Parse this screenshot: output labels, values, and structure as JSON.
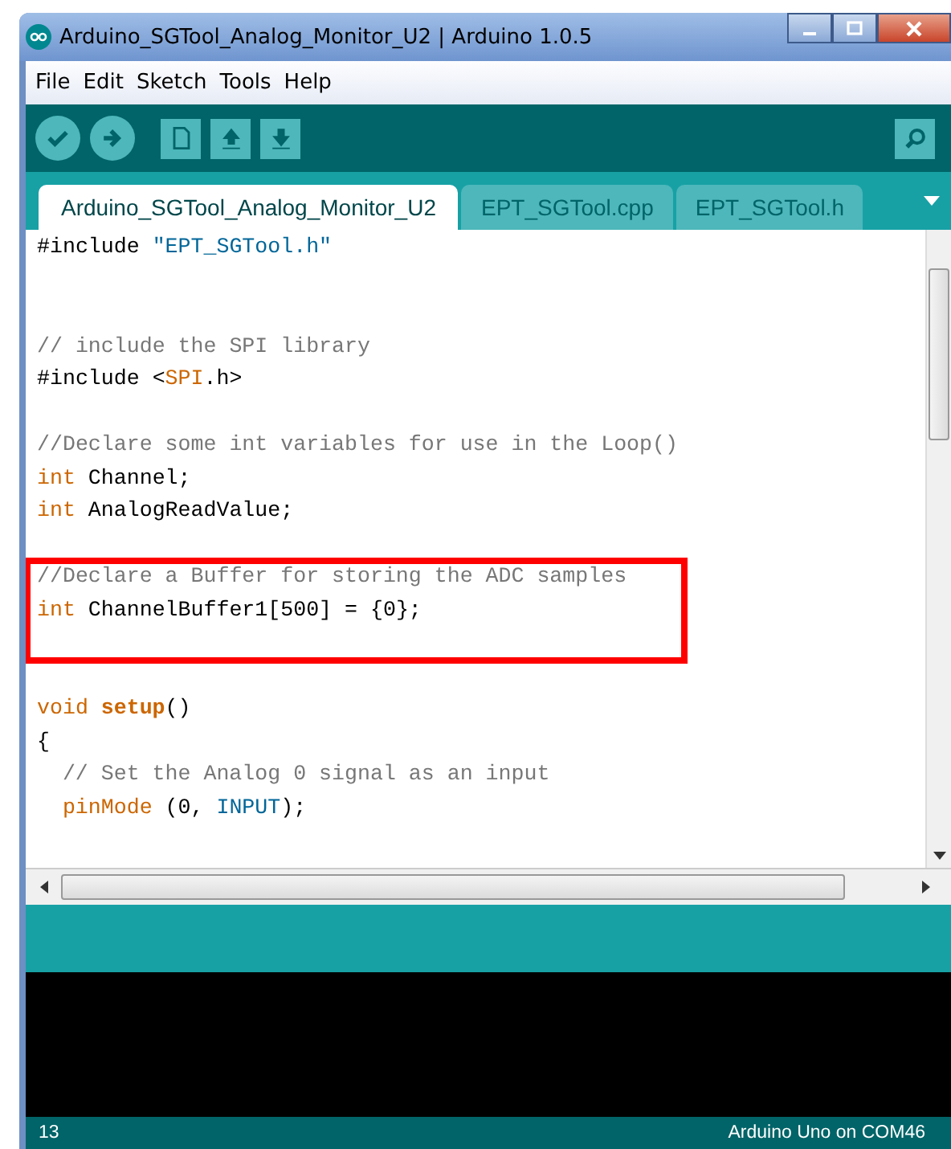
{
  "window": {
    "title": "Arduino_SGTool_Analog_Monitor_U2 | Arduino 1.0.5"
  },
  "menu": [
    "File",
    "Edit",
    "Sketch",
    "Tools",
    "Help"
  ],
  "tabs": [
    {
      "label": "Arduino_SGTool_Analog_Monitor_U2",
      "selected": true
    },
    {
      "label": "EPT_SGTool.cpp",
      "selected": false
    },
    {
      "label": "EPT_SGTool.h",
      "selected": false
    }
  ],
  "code": {
    "blocks": [
      {
        "highlighted": false,
        "lines": [
          {
            "kind": "code",
            "tokens": [
              {
                "kind": "plain",
                "text": "#include "
              },
              {
                "kind": "string",
                "text": "\"EPT_SGTool.h\""
              }
            ]
          },
          {
            "kind": "blank"
          },
          {
            "kind": "blank"
          },
          {
            "kind": "code",
            "tokens": [
              {
                "kind": "comment",
                "text": "// include the SPI library"
              }
            ]
          },
          {
            "kind": "code",
            "tokens": [
              {
                "kind": "plain",
                "text": "#include <"
              },
              {
                "kind": "keyword",
                "text": "SPI"
              },
              {
                "kind": "plain",
                "text": ".h>"
              }
            ]
          },
          {
            "kind": "blank"
          },
          {
            "kind": "code",
            "tokens": [
              {
                "kind": "comment",
                "text": "//Declare some int variables for use in the Loop()"
              }
            ]
          },
          {
            "kind": "code",
            "tokens": [
              {
                "kind": "keyword",
                "text": "int"
              },
              {
                "kind": "plain",
                "text": " Channel;"
              }
            ]
          },
          {
            "kind": "code",
            "tokens": [
              {
                "kind": "keyword",
                "text": "int"
              },
              {
                "kind": "plain",
                "text": " AnalogReadValue;"
              }
            ]
          },
          {
            "kind": "blank"
          }
        ]
      },
      {
        "highlighted": true,
        "lines": [
          {
            "kind": "code",
            "tokens": [
              {
                "kind": "comment",
                "text": "//Declare a Buffer for storing the ADC samples"
              }
            ]
          },
          {
            "kind": "code",
            "tokens": [
              {
                "kind": "keyword",
                "text": "int"
              },
              {
                "kind": "plain",
                "text": " ChannelBuffer1[500] = {0};"
              }
            ]
          },
          {
            "kind": "blank"
          }
        ]
      },
      {
        "highlighted": false,
        "lines": [
          {
            "kind": "blank"
          },
          {
            "kind": "code",
            "tokens": [
              {
                "kind": "keyword",
                "text": "void",
                "spaced": true
              },
              {
                "kind": "function",
                "text": "setup"
              },
              {
                "kind": "plain",
                "text": "()"
              }
            ]
          },
          {
            "kind": "code",
            "tokens": [
              {
                "kind": "plain",
                "text": "{"
              }
            ]
          },
          {
            "kind": "code",
            "indented": true,
            "tokens": [
              {
                "kind": "comment",
                "text": "// Set the Analog 0 signal as an input"
              }
            ]
          },
          {
            "kind": "code",
            "indented": true,
            "tokens": [
              {
                "kind": "keyword",
                "text": "pinMode"
              },
              {
                "kind": "plain",
                "text": " (0, "
              },
              {
                "kind": "string",
                "text": "INPUT"
              },
              {
                "kind": "plain",
                "text": ");"
              }
            ]
          }
        ]
      }
    ]
  },
  "status_bar": {
    "line": "13",
    "board": "Arduino Uno on COM46"
  }
}
